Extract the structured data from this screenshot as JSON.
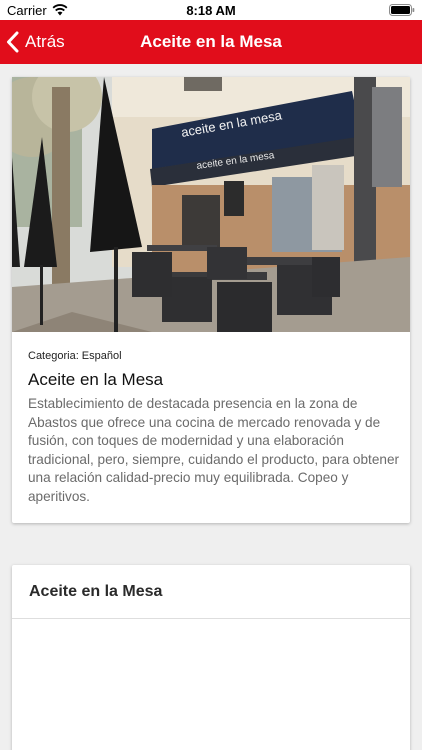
{
  "status_bar": {
    "carrier": "Carrier",
    "time": "8:18 AM",
    "icons": [
      "wifi-icon",
      "battery-icon"
    ]
  },
  "nav_bar": {
    "back_label": "Atrás",
    "title": "Aceite en la Mesa",
    "color": "#e10d1b",
    "icons": [
      "chevron-left-icon"
    ]
  },
  "detail": {
    "photo_signage": [
      "aceite en la mesa",
      "aceite en la mesa"
    ],
    "category": "Categoria: Español",
    "name": "Aceite en la Mesa",
    "description": "Establecimiento de destacada presencia en la zona de Abastos que ofrece una cocina de mercado renovada y de fusión, con toques de modernidad y una elaboración tradicional, pero, siempre, cuidando el producto, para obtener una relación calidad-precio muy equilibrada. Copeo y aperitivos."
  },
  "map_card": {
    "title": "Aceite en la Mesa"
  }
}
